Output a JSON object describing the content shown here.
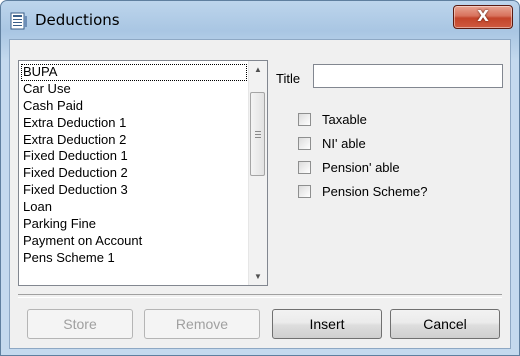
{
  "window": {
    "title": "Deductions",
    "close_label": "X"
  },
  "list": {
    "items": [
      "BUPA",
      "Car Use",
      "Cash Paid",
      "Extra Deduction 1",
      "Extra Deduction 2",
      "Fixed Deduction 1",
      "Fixed Deduction 2",
      "Fixed Deduction 3",
      "Loan",
      "Parking Fine",
      "Payment on Account",
      "Pens Scheme 1"
    ]
  },
  "form": {
    "title_label": "Title",
    "title_value": "",
    "checkboxes": [
      {
        "label": "Taxable",
        "checked": false
      },
      {
        "label": "NI' able",
        "checked": false
      },
      {
        "label": "Pension' able",
        "checked": false
      },
      {
        "label": "Pension Scheme?",
        "checked": false
      }
    ]
  },
  "buttons": {
    "store": "Store",
    "remove": "Remove",
    "insert": "Insert",
    "cancel": "Cancel"
  }
}
